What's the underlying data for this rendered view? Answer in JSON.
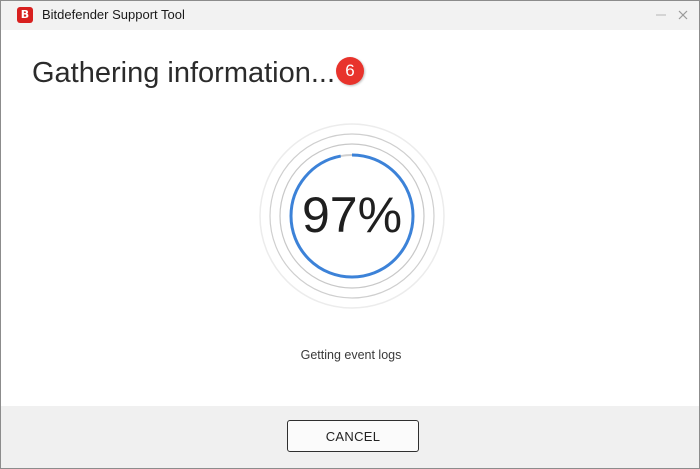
{
  "window": {
    "title": "Bitdefender Support Tool",
    "logo_letter": "B",
    "logo_color": "#d8201f",
    "controls": [
      "minimize-icon",
      "close-icon"
    ]
  },
  "main": {
    "title": "Gathering information...",
    "step_badge": "6",
    "step_badge_color": "#e8332c",
    "progress": {
      "percent": 97,
      "label": "97%",
      "ring_color": "#3c82d8",
      "track_color": "#d0d0d0"
    },
    "status": "Getting event logs"
  },
  "footer": {
    "cancel_label": "CANCEL"
  }
}
